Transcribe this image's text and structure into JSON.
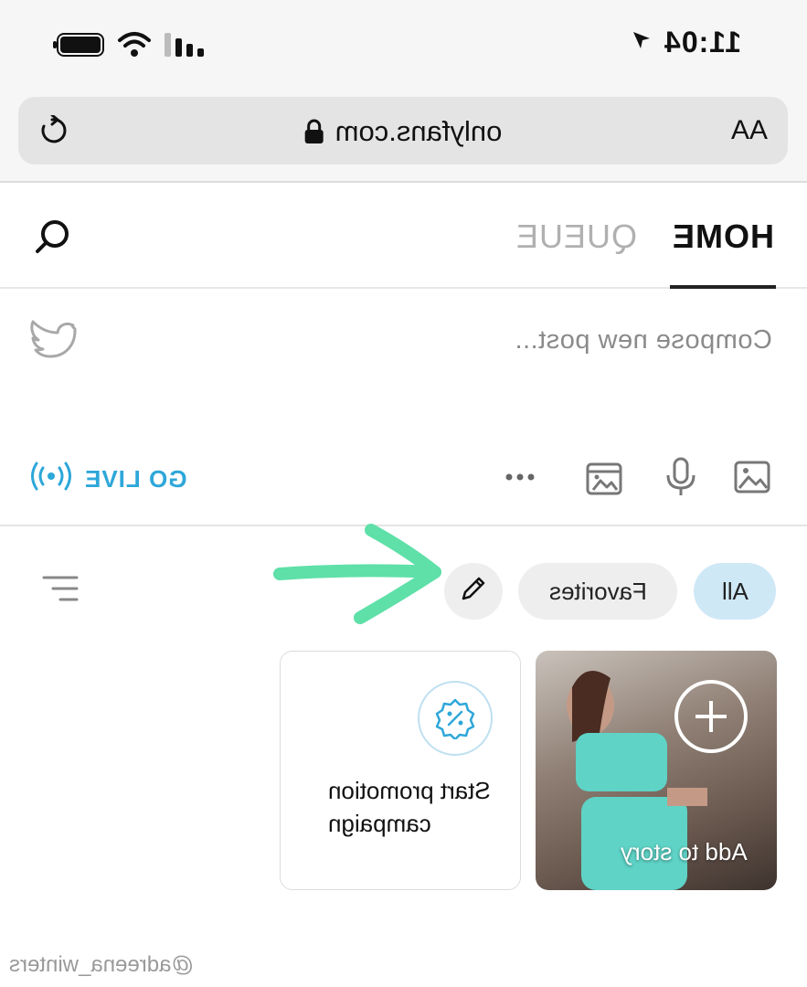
{
  "status_bar": {
    "time": "11:04"
  },
  "browser": {
    "aa_label": "AA",
    "url": "onlyfans.com"
  },
  "tabs": [
    {
      "label": "HOME",
      "active": true
    },
    {
      "label": "QUEUE",
      "active": false
    }
  ],
  "compose": {
    "placeholder": "Compose new post...",
    "go_live_label": "GO LIVE"
  },
  "filters": {
    "all_label": "All",
    "favorites_label": "Favorites"
  },
  "stories": {
    "add_to_story_label": "Add to story",
    "promo_label": "Start promotion campaign"
  },
  "watermark": "@adreena_winters",
  "colors": {
    "accent": "#2ea7d9",
    "chip_active": "#cfe8f6",
    "annotation_arrow": "#5ee0a8"
  }
}
